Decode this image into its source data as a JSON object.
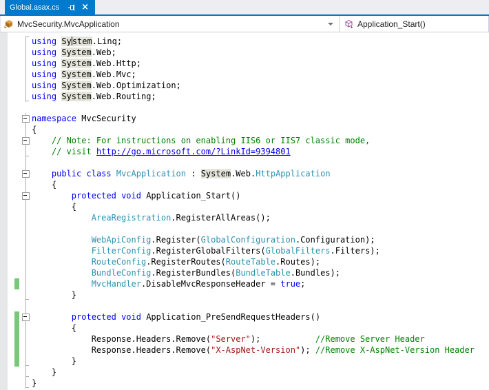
{
  "tab": {
    "title": "Global.asax.cs"
  },
  "navbar": {
    "scope": "MvcSecurity.MvcApplication",
    "member": "Application_Start()"
  },
  "icons": {
    "pin_icon": "sideways-pin",
    "close_icon": "x-cross",
    "class_icon": "orange-cube",
    "method_icon": "purple-cube-with-star",
    "chevron_down_icon": "triangle-down"
  },
  "colors": {
    "accent_blue": "#007acc",
    "tab_strip_bg": "#eeeef2",
    "keyword": "#0000ff",
    "type_name": "#2b91af",
    "comment": "#008000",
    "string": "#a31515",
    "reference_highlight": "#e4e4da",
    "change_bar_green": "#77c877",
    "indicator_margin": "#e6e7e8"
  },
  "code": {
    "lines": [
      {
        "g": "vT",
        "s": [
          [
            "k",
            "using"
          ],
          [
            "p",
            " "
          ],
          [
            "h",
            "Sy"
          ],
          [
            "caret",
            ""
          ],
          [
            "h",
            "stem"
          ],
          [
            "p",
            ".Linq;"
          ]
        ]
      },
      {
        "g": "v",
        "s": [
          [
            "k",
            "using"
          ],
          [
            "p",
            " "
          ],
          [
            "h",
            "System"
          ],
          [
            "p",
            ".Web;"
          ]
        ]
      },
      {
        "g": "v",
        "s": [
          [
            "k",
            "using"
          ],
          [
            "p",
            " "
          ],
          [
            "h",
            "System"
          ],
          [
            "p",
            ".Web.Http;"
          ]
        ]
      },
      {
        "g": "v",
        "s": [
          [
            "k",
            "using"
          ],
          [
            "p",
            " "
          ],
          [
            "h",
            "System"
          ],
          [
            "p",
            ".Web.Mvc;"
          ]
        ]
      },
      {
        "g": "v",
        "s": [
          [
            "k",
            "using"
          ],
          [
            "p",
            " "
          ],
          [
            "h",
            "System"
          ],
          [
            "p",
            ".Web.Optimization;"
          ]
        ]
      },
      {
        "g": "vt",
        "s": [
          [
            "k",
            "using"
          ],
          [
            "p",
            " "
          ],
          [
            "h",
            "System"
          ],
          [
            "p",
            ".Web.Routing;"
          ]
        ]
      },
      {
        "g": "",
        "s": []
      },
      {
        "g": "vb",
        "s": [
          [
            "k",
            "namespace"
          ],
          [
            "p",
            " MvcSecurity"
          ]
        ]
      },
      {
        "g": "v",
        "s": [
          [
            "p",
            "{"
          ]
        ]
      },
      {
        "g": "vb",
        "s": [
          [
            "p",
            "    "
          ],
          [
            "c",
            "// Note: For instructions on enabling IIS6 or IIS7 classic mode,"
          ]
        ]
      },
      {
        "g": "vt",
        "s": [
          [
            "p",
            "    "
          ],
          [
            "c",
            "// visit "
          ],
          [
            "a",
            "http://go.microsoft.com/?LinkId=9394801"
          ]
        ]
      },
      {
        "g": "v",
        "s": []
      },
      {
        "g": "vb",
        "s": [
          [
            "p",
            "    "
          ],
          [
            "k",
            "public"
          ],
          [
            "p",
            " "
          ],
          [
            "k",
            "class"
          ],
          [
            "p",
            " "
          ],
          [
            "t",
            "MvcApplication"
          ],
          [
            "p",
            " : "
          ],
          [
            "h",
            "System"
          ],
          [
            "p",
            ".Web."
          ],
          [
            "t",
            "HttpApplication"
          ]
        ]
      },
      {
        "g": "v",
        "s": [
          [
            "p",
            "    {"
          ]
        ]
      },
      {
        "g": "vb",
        "s": [
          [
            "p",
            "        "
          ],
          [
            "k",
            "protected"
          ],
          [
            "p",
            " "
          ],
          [
            "k",
            "void"
          ],
          [
            "p",
            " Application_Start()"
          ]
        ]
      },
      {
        "g": "v",
        "s": [
          [
            "p",
            "        {"
          ]
        ]
      },
      {
        "g": "v",
        "s": [
          [
            "p",
            "            "
          ],
          [
            "t",
            "AreaRegistration"
          ],
          [
            "p",
            ".RegisterAllAreas();"
          ]
        ]
      },
      {
        "g": "v",
        "s": []
      },
      {
        "g": "v",
        "s": [
          [
            "p",
            "            "
          ],
          [
            "t",
            "WebApiConfig"
          ],
          [
            "p",
            ".Register("
          ],
          [
            "t",
            "GlobalConfiguration"
          ],
          [
            "p",
            ".Configuration);"
          ]
        ]
      },
      {
        "g": "v",
        "s": [
          [
            "p",
            "            "
          ],
          [
            "t",
            "FilterConfig"
          ],
          [
            "p",
            ".RegisterGlobalFilters("
          ],
          [
            "t",
            "GlobalFilters"
          ],
          [
            "p",
            ".Filters);"
          ]
        ]
      },
      {
        "g": "v",
        "s": [
          [
            "p",
            "            "
          ],
          [
            "t",
            "RouteConfig"
          ],
          [
            "p",
            ".RegisterRoutes("
          ],
          [
            "t",
            "RouteTable"
          ],
          [
            "p",
            ".Routes);"
          ]
        ]
      },
      {
        "g": "v",
        "s": [
          [
            "p",
            "            "
          ],
          [
            "t",
            "BundleConfig"
          ],
          [
            "p",
            ".RegisterBundles("
          ],
          [
            "t",
            "BundleTable"
          ],
          [
            "p",
            ".Bundles);"
          ]
        ]
      },
      {
        "g": "v",
        "bar": 1,
        "s": [
          [
            "p",
            "            "
          ],
          [
            "t",
            "MvcHandler"
          ],
          [
            "p",
            ".DisableMvcResponseHeader = "
          ],
          [
            "k",
            "true"
          ],
          [
            "p",
            ";"
          ]
        ]
      },
      {
        "g": "vt",
        "s": [
          [
            "p",
            "        }"
          ]
        ]
      },
      {
        "g": "v",
        "s": []
      },
      {
        "g": "vb",
        "bar": 1,
        "s": [
          [
            "p",
            "        "
          ],
          [
            "k",
            "protected"
          ],
          [
            "p",
            " "
          ],
          [
            "k",
            "void"
          ],
          [
            "p",
            " Application_PreSendRequestHeaders()"
          ]
        ]
      },
      {
        "g": "v",
        "bar": 1,
        "s": [
          [
            "p",
            "        {"
          ]
        ]
      },
      {
        "g": "v",
        "bar": 1,
        "s": [
          [
            "p",
            "            Response.Headers.Remove("
          ],
          [
            "s",
            "\"Server\""
          ],
          [
            "p",
            ");           "
          ],
          [
            "c",
            "//Remove Server Header"
          ]
        ]
      },
      {
        "g": "v",
        "bar": 1,
        "s": [
          [
            "p",
            "            Response.Headers.Remove("
          ],
          [
            "s",
            "\"X-AspNet-Version\""
          ],
          [
            "p",
            "); "
          ],
          [
            "c",
            "//Remove X-AspNet-Version Header"
          ]
        ]
      },
      {
        "g": "vt",
        "bar": 1,
        "s": [
          [
            "p",
            "        }"
          ]
        ]
      },
      {
        "g": "vt",
        "s": [
          [
            "p",
            "    }"
          ]
        ]
      },
      {
        "g": "vt",
        "s": [
          [
            "p",
            "}"
          ]
        ]
      }
    ]
  }
}
